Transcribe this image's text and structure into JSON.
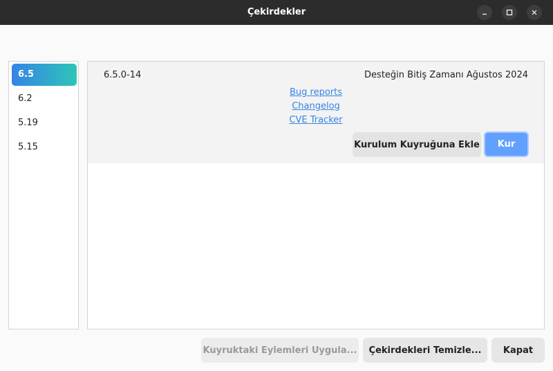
{
  "window": {
    "title": "Çekirdekler"
  },
  "sidebar": {
    "items": [
      {
        "label": "6.5",
        "active": true
      },
      {
        "label": "6.2",
        "active": false
      },
      {
        "label": "5.19",
        "active": false
      },
      {
        "label": "5.15",
        "active": false
      }
    ]
  },
  "kernel": {
    "version": "6.5.0-14",
    "eol": "Desteğin Bitiş Zamanı Ağustos 2024",
    "links": {
      "bug_reports": "Bug reports",
      "changelog": "Changelog",
      "cve_tracker": "CVE Tracker"
    },
    "queue_button": "Kurulum Kuyruğuna Ekle",
    "install_button": "Kur"
  },
  "footer": {
    "apply_queue": "Kuyruktaki Eylemleri Uygula...",
    "clean_kernels": "Çekirdekleri Temizle...",
    "close": "Kapat"
  },
  "colors": {
    "accent": "#3584e4",
    "install": "#62a0ff",
    "titlebar": "#2c2c2c"
  }
}
